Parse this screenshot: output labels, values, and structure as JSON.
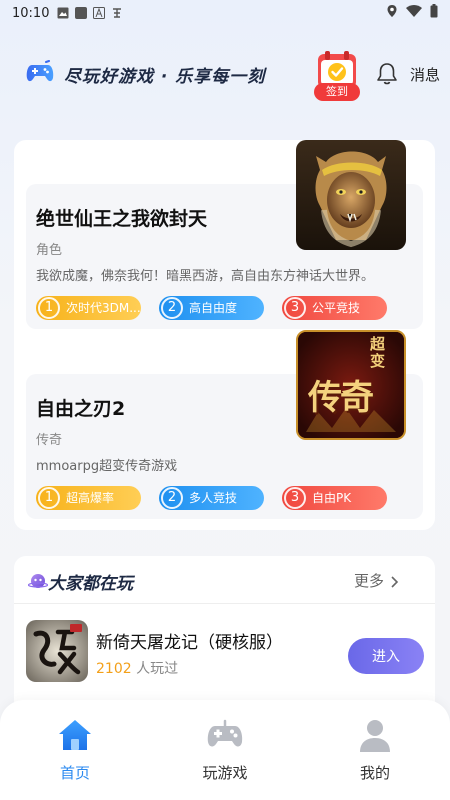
{
  "status_bar": {
    "time": "10:10"
  },
  "header": {
    "slogan": "尽玩好游戏 · 乐享每一刻",
    "signin_label": "签到",
    "messages_label": "消息"
  },
  "featured": {
    "games": [
      {
        "title": "绝世仙王之我欲封天",
        "category": "角色",
        "description": "我欲成魔，佛奈我何！暗黑西游，高自由东方神话大世界。",
        "tags": [
          {
            "num": "1",
            "text": "次时代3DM..."
          },
          {
            "num": "2",
            "text": "高自由度"
          },
          {
            "num": "3",
            "text": "公平竞技"
          }
        ]
      },
      {
        "title": "自由之刃2",
        "category": "传奇",
        "description": "mmoarpg超变传奇游戏",
        "cover_text_small": "超变",
        "cover_text_big": "传奇",
        "tags": [
          {
            "num": "1",
            "text": "超高爆率"
          },
          {
            "num": "2",
            "text": "多人竞技"
          },
          {
            "num": "3",
            "text": "自由PK"
          }
        ]
      }
    ]
  },
  "popular": {
    "title": "大家都在玩",
    "more_label": "更多",
    "game": {
      "name": "新倚天屠龙记（硬核服）",
      "played_count": "2102",
      "played_suffix": "人玩过",
      "enter_label": "进入"
    }
  },
  "bottom_nav": {
    "items": [
      {
        "label": "首页",
        "icon": "home-icon",
        "active": true
      },
      {
        "label": "玩游戏",
        "icon": "gamepad-icon",
        "active": false
      },
      {
        "label": "我的",
        "icon": "profile-icon",
        "active": false
      }
    ]
  },
  "colors": {
    "accent_blue": "#2b8af0",
    "enter_button": "#7470ee",
    "signin_red": "#f03a3a",
    "played_count": "#f3a01a"
  }
}
